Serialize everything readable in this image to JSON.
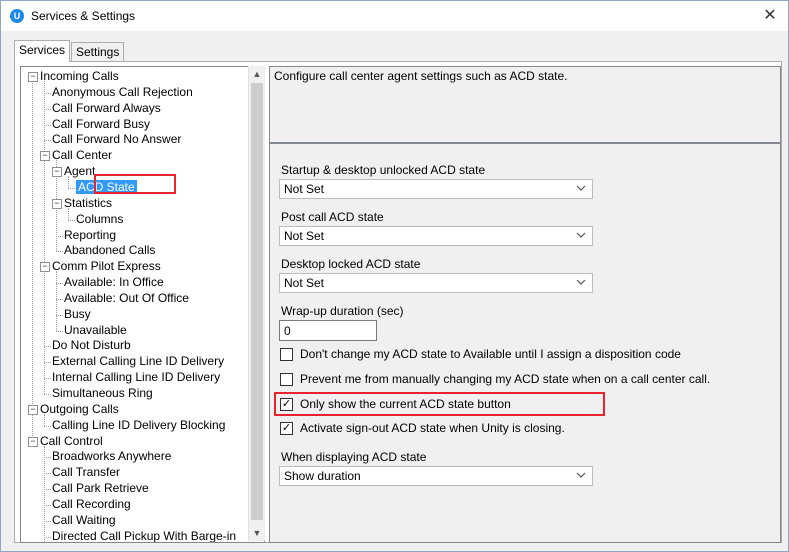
{
  "window": {
    "title": "Services & Settings",
    "app_icon": "U"
  },
  "tabs": [
    {
      "label": "Services"
    },
    {
      "label": "Settings"
    }
  ],
  "tree": {
    "nodes": [
      {
        "label": "Incoming Calls"
      },
      {
        "label": "Anonymous Call Rejection"
      },
      {
        "label": "Call Forward Always"
      },
      {
        "label": "Call Forward Busy"
      },
      {
        "label": "Call Forward No Answer"
      },
      {
        "label": "Call Center"
      },
      {
        "label": "Agent"
      },
      {
        "label": "ACD State"
      },
      {
        "label": "Statistics"
      },
      {
        "label": "Columns"
      },
      {
        "label": "Reporting"
      },
      {
        "label": "Abandoned Calls"
      },
      {
        "label": "Comm Pilot Express"
      },
      {
        "label": "Available: In Office"
      },
      {
        "label": "Available: Out Of Office"
      },
      {
        "label": "Busy"
      },
      {
        "label": "Unavailable"
      },
      {
        "label": "Do Not Disturb"
      },
      {
        "label": "External Calling Line ID Delivery"
      },
      {
        "label": "Internal Calling Line ID Delivery"
      },
      {
        "label": "Simultaneous Ring"
      },
      {
        "label": "Outgoing Calls"
      },
      {
        "label": "Calling Line ID Delivery Blocking"
      },
      {
        "label": "Call Control"
      },
      {
        "label": "Broadworks Anywhere"
      },
      {
        "label": "Call Transfer"
      },
      {
        "label": "Call Park Retrieve"
      },
      {
        "label": "Call Recording"
      },
      {
        "label": "Call Waiting"
      },
      {
        "label": "Directed Call Pickup With Barge-in"
      }
    ]
  },
  "description": "Configure call center agent settings such as ACD state.",
  "settings": {
    "startup_label": "Startup & desktop unlocked ACD state",
    "startup_value": "Not Set",
    "post_call_label": "Post call ACD state",
    "post_call_value": "Not Set",
    "locked_label": "Desktop locked ACD state",
    "locked_value": "Not Set",
    "wrapup_label": "Wrap-up duration (sec)",
    "wrapup_value": "0",
    "checkboxes": [
      {
        "label": "Don't change my ACD state to Available until I assign a disposition code",
        "checked": false
      },
      {
        "label": "Prevent me from manually changing my ACD state when on a call center call.",
        "checked": false
      },
      {
        "label": "Only show the current ACD state button",
        "checked": true
      },
      {
        "label": "Activate sign-out ACD state when Unity is closing.",
        "checked": true
      }
    ],
    "display_label": "When displaying ACD state",
    "display_value": "Show duration"
  },
  "highlight_color": "#e8242f",
  "selection_color": "#3399ff"
}
